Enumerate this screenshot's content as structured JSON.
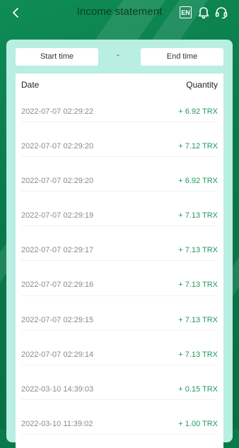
{
  "header": {
    "title": "Income statement",
    "lang_label": "EN"
  },
  "filters": {
    "start_label": "Start time",
    "separator": "-",
    "end_label": "End time"
  },
  "table": {
    "columns": [
      "Date",
      "Quantity"
    ],
    "rows": [
      {
        "date": "2022-07-07 02:29:22",
        "quantity": "+ 6.92 TRX"
      },
      {
        "date": "2022-07-07 02:29:20",
        "quantity": "+ 7.12 TRX"
      },
      {
        "date": "2022-07-07 02:29:20",
        "quantity": "+ 6.92 TRX"
      },
      {
        "date": "2022-07-07 02:29:19",
        "quantity": "+ 7.13 TRX"
      },
      {
        "date": "2022-07-07 02:29:17",
        "quantity": "+ 7.13 TRX"
      },
      {
        "date": "2022-07-07 02:29:16",
        "quantity": "+ 7.13 TRX"
      },
      {
        "date": "2022-07-07 02:29:15",
        "quantity": "+ 7.13 TRX"
      },
      {
        "date": "2022-07-07 02:29:14",
        "quantity": "+ 7.13 TRX"
      },
      {
        "date": "2022-03-10 14:39:03",
        "quantity": "+ 0.15 TRX"
      },
      {
        "date": "2022-03-10 11:39:02",
        "quantity": "+ 1.00 TRX"
      }
    ]
  },
  "colors": {
    "background": "#0a7a4a",
    "card": "#b9eee2",
    "amount": "#1e9a5a"
  }
}
